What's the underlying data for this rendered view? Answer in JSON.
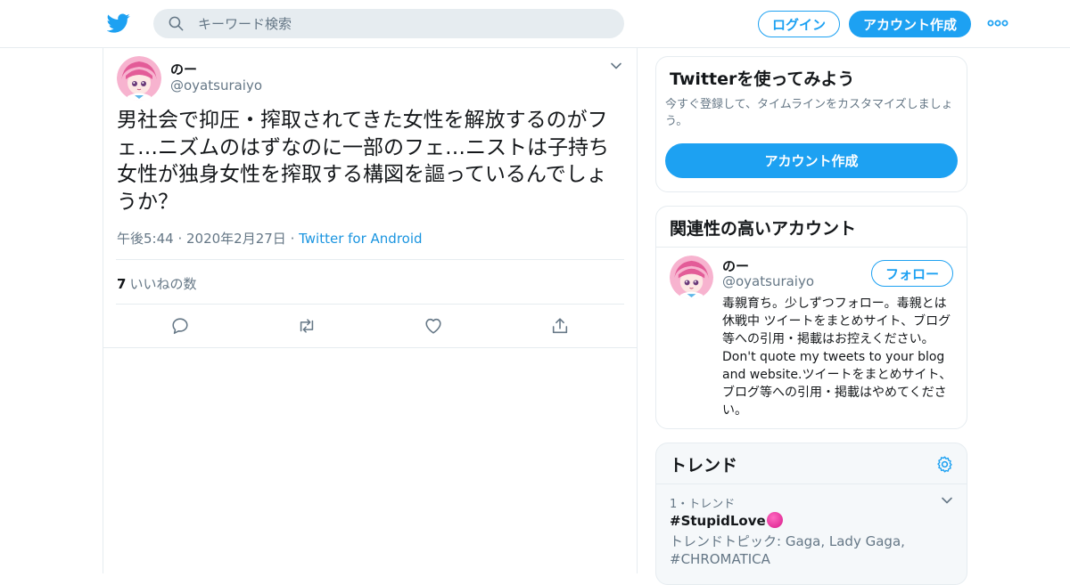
{
  "header": {
    "search_placeholder": "キーワード検索",
    "login_label": "ログイン",
    "signup_label": "アカウント作成",
    "brand_color": "#1da1f2"
  },
  "tweet": {
    "author_name": "のー",
    "author_handle": "@oyatsuraiyo",
    "text": "男社会で抑圧・搾取されてきた女性を解放するのがフェ…ニズムのはずなのに一部のフェ…ニストは子持ち女性が独身女性を搾取する構図を謳っているんでしょうか？",
    "timestamp": "午後5:44 · 2020年2月27日",
    "meta_separator": " · ",
    "source": "Twitter for Android",
    "likes_count": "7",
    "likes_label": "いいねの数",
    "actions": [
      "reply-icon",
      "retweet-icon",
      "like-icon",
      "share-icon"
    ]
  },
  "signup_card": {
    "title": "Twitterを使ってみよう",
    "description": "今すぐ登録して、タイムラインをカスタマイズしましょう。",
    "button_label": "アカウント作成"
  },
  "related_card": {
    "title": "関連性の高いアカウント",
    "name": "のー",
    "handle": "@oyatsuraiyo",
    "follow_label": "フォロー",
    "bio": "毒親育ち。少しずつフォロー。毒親とは休戦中 ツイートをまとめサイト、ブログ等への引用・掲載はお控えください。Don't quote my tweets to your blog and website.ツイートをまとめサイト、ブログ等への引用・掲載はやめてください。"
  },
  "trends_card": {
    "title": "トレンド",
    "items": [
      {
        "meta": "1・トレンド",
        "name": "#StupidLove",
        "topic": "トレンドトピック: Gaga, Lady Gaga, #CHROMATICA"
      }
    ]
  }
}
